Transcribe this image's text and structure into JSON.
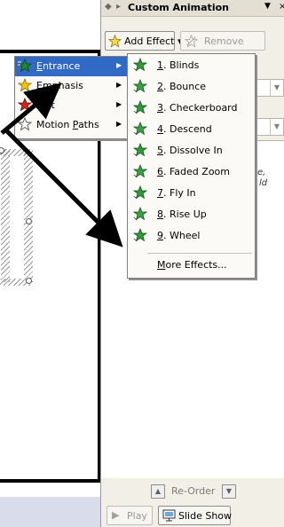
{
  "pane": {
    "title": "Custom Animation",
    "back_glyph": "◆",
    "forward_glyph": "▸",
    "dropdown_glyph": "▼",
    "close_glyph": "×",
    "add_effect_label": "Add Effect ▾",
    "remove_label": "Remove",
    "hint_line1": "e,",
    "hint_line2": "ld",
    "reorder_label": "Re-Order",
    "play_label": "Play",
    "slideshow_label": "Slide Show"
  },
  "add_effect_menu": {
    "items": [
      {
        "label": "Entrance",
        "accel": "E",
        "rest": "ntrance",
        "star_color": "#1f8a2a",
        "selected": true
      },
      {
        "label": "Emphasis",
        "accel": "m",
        "pre": "E",
        "rest": "phasis",
        "star_color": "#f2c500",
        "selected": false
      },
      {
        "label": "Exit",
        "accel": "x",
        "pre": "E",
        "rest": "it",
        "star_color": "#d9231a",
        "selected": false
      },
      {
        "label": "Motion Paths",
        "accel": "P",
        "pre": "Motion ",
        "rest": "aths",
        "star_color": "#ffffff",
        "selected": false
      }
    ],
    "submenu_glyph": "▶"
  },
  "entrance_menu": {
    "items": [
      {
        "num": "1",
        "text": ". Blinds"
      },
      {
        "num": "2",
        "text": ". Bounce"
      },
      {
        "num": "3",
        "text": ". Checkerboard"
      },
      {
        "num": "4",
        "text": ". Descend"
      },
      {
        "num": "5",
        "text": ". Dissolve In"
      },
      {
        "num": "6",
        "text": ". Faded Zoom"
      },
      {
        "num": "7",
        "text": ". Fly In"
      },
      {
        "num": "8",
        "text": ". Rise Up"
      },
      {
        "num": "9",
        "text": ". Wheel"
      }
    ],
    "more_accel": "M",
    "more_rest": "ore Effects..."
  }
}
